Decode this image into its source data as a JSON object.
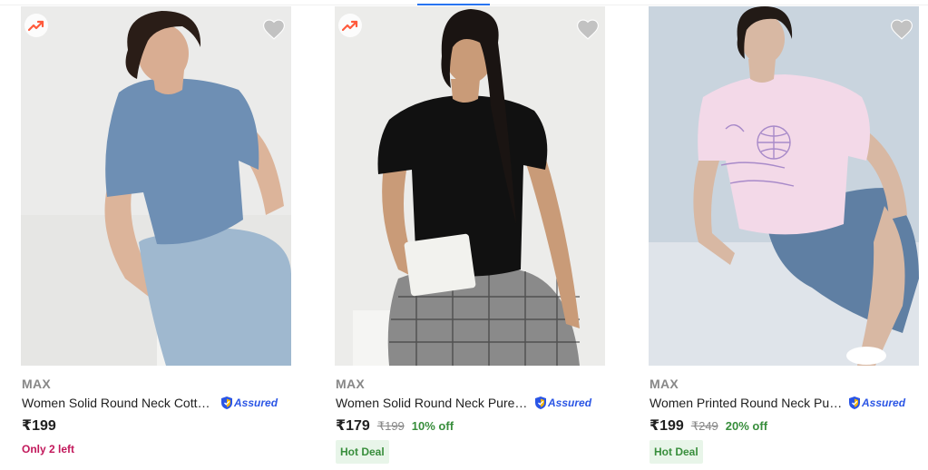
{
  "products": [
    {
      "brand": "MAX",
      "title": "Women Solid Round Neck Cotton Blend T-Shirt",
      "assured": "Assured",
      "price": "₹199",
      "mrp": "",
      "discount": "",
      "stock_note": "Only 2 left",
      "deal_badge": "",
      "tee_color": "#6e8fb4"
    },
    {
      "brand": "MAX",
      "title": "Women Solid Round Neck Pure Cotton T-Shirt",
      "assured": "Assured",
      "price": "₹179",
      "mrp": "₹199",
      "discount": "10% off",
      "stock_note": "",
      "deal_badge": "Hot Deal",
      "tee_color": "#111111"
    },
    {
      "brand": "MAX",
      "title": "Women Printed Round Neck Pure Cotton T-Shirt",
      "assured": "Assured",
      "price": "₹199",
      "mrp": "₹249",
      "discount": "20% off",
      "stock_note": "",
      "deal_badge": "Hot Deal",
      "tee_color": "#f3d9e8"
    }
  ],
  "icons": {
    "trending": "trending-up-icon",
    "wishlist": "heart-icon",
    "assured": "assured-shield-icon"
  },
  "colors": {
    "accent": "#2874f0",
    "discount_green": "#388e3c",
    "stock_pink": "#c2185b",
    "heart_grey": "#c2c2c2"
  }
}
